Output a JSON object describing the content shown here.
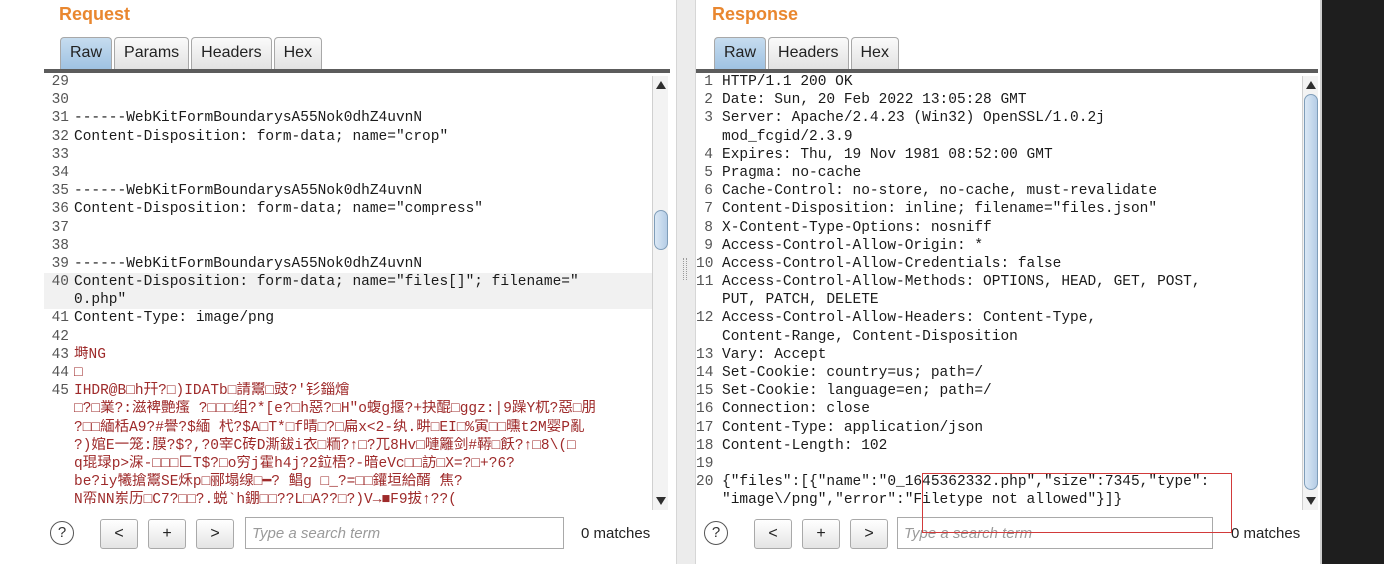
{
  "request": {
    "title": "Request",
    "tabs": [
      "Raw",
      "Params",
      "Headers",
      "Hex"
    ],
    "active_tab": "Raw",
    "lines": [
      {
        "n": "29",
        "t": ""
      },
      {
        "n": "30",
        "t": ""
      },
      {
        "n": "31",
        "t": "------WebKitFormBoundarysA55Nok0dhZ4uvnN"
      },
      {
        "n": "32",
        "t": "Content-Disposition: form-data; name=\"crop\""
      },
      {
        "n": "33",
        "t": ""
      },
      {
        "n": "34",
        "t": ""
      },
      {
        "n": "35",
        "t": "------WebKitFormBoundarysA55Nok0dhZ4uvnN"
      },
      {
        "n": "36",
        "t": "Content-Disposition: form-data; name=\"compress\""
      },
      {
        "n": "37",
        "t": ""
      },
      {
        "n": "38",
        "t": ""
      },
      {
        "n": "39",
        "t": "------WebKitFormBoundarysA55Nok0dhZ4uvnN"
      },
      {
        "n": "40",
        "t": "Content-Disposition: form-data; name=\"files[]\"; filename=\""
      },
      {
        "n": "",
        "t": "0.php\""
      },
      {
        "n": "41",
        "t": "Content-Type: image/png"
      },
      {
        "n": "42",
        "t": ""
      },
      {
        "n": "43",
        "t": "塒NG"
      },
      {
        "n": "44",
        "t": "□"
      },
      {
        "n": "45",
        "t": "IHDR@B□h幵?□)IDATb□請鬻□豉?'钐錙燴"
      },
      {
        "n": "",
        "t": "□?□業?:滋裨艶瘙 ?□□□组?*[e?□h惡?□H\"o蝮g揠?+抉醌□ggz:|9躁Y杌?惡□朋"
      },
      {
        "n": "",
        "t": "?□□緬栝A9?#譽?$緬 杙?$A□T*□f晴□?□扁x<2-纨.畊□EI□%寅□□曛t2M婴P亂"
      },
      {
        "n": "",
        "t": "?)婠E一笼:膜?$?,?0宰C砖D澌鈸i衣□粫?↑□?兀8Hv□嗹籬剑#鞯□飫?↑□8\\(□"
      },
      {
        "n": "",
        "t": "q琨琭p>淭-□□□匚T$?□o穷j霍h4j?2鉝梧?-暗eVc□□訪□X=?□+?6?"
      },
      {
        "n": "",
        "t": "be?iy犧搶鬻SE秌p□郦塌缐□━? 鲳g □_?=□□鑵垣給醑 焦?"
      },
      {
        "n": "",
        "t": "N帟NN岽历□C7?□□?.蜕`h錋□□??L□A??□?)V→■F9拔↑??("
      }
    ],
    "highlight_index": 11,
    "binary_start": 15,
    "search": {
      "placeholder": "Type a search term",
      "matches": "0 matches"
    },
    "buttons": {
      "help": "?",
      "prev": "<",
      "add": "+",
      "next": ">"
    }
  },
  "response": {
    "title": "Response",
    "tabs": [
      "Raw",
      "Headers",
      "Hex"
    ],
    "active_tab": "Raw",
    "lines": [
      {
        "n": "1",
        "t": "HTTP/1.1 200 OK"
      },
      {
        "n": "2",
        "t": "Date: Sun, 20 Feb 2022 13:05:28 GMT"
      },
      {
        "n": "3",
        "t": "Server: Apache/2.4.23 (Win32) OpenSSL/1.0.2j"
      },
      {
        "n": "",
        "t": "mod_fcgid/2.3.9"
      },
      {
        "n": "4",
        "t": "Expires: Thu, 19 Nov 1981 08:52:00 GMT"
      },
      {
        "n": "5",
        "t": "Pragma: no-cache"
      },
      {
        "n": "6",
        "t": "Cache-Control: no-store, no-cache, must-revalidate"
      },
      {
        "n": "7",
        "t": "Content-Disposition: inline; filename=\"files.json\""
      },
      {
        "n": "8",
        "t": "X-Content-Type-Options: nosniff"
      },
      {
        "n": "9",
        "t": "Access-Control-Allow-Origin: *"
      },
      {
        "n": "10",
        "t": "Access-Control-Allow-Credentials: false"
      },
      {
        "n": "11",
        "t": "Access-Control-Allow-Methods: OPTIONS, HEAD, GET, POST,"
      },
      {
        "n": "",
        "t": "PUT, PATCH, DELETE"
      },
      {
        "n": "12",
        "t": "Access-Control-Allow-Headers: Content-Type,"
      },
      {
        "n": "",
        "t": "Content-Range, Content-Disposition"
      },
      {
        "n": "13",
        "t": "Vary: Accept"
      },
      {
        "n": "14",
        "t": "Set-Cookie: country=us; path=/"
      },
      {
        "n": "15",
        "t": "Set-Cookie: language=en; path=/"
      },
      {
        "n": "16",
        "t": "Connection: close"
      },
      {
        "n": "17",
        "t": "Content-Type: application/json"
      },
      {
        "n": "18",
        "t": "Content-Length: 102"
      },
      {
        "n": "19",
        "t": ""
      },
      {
        "n": "20",
        "t": "{\"files\":[{\"name\":\"0_1645362332.php\",\"size\":7345,\"type\":"
      },
      {
        "n": "",
        "t": "\"image\\/png\",\"error\":\"Filetype not allowed\"}]}"
      }
    ],
    "search": {
      "placeholder": "Type a search term",
      "matches": "0 matches"
    },
    "buttons": {
      "help": "?",
      "prev": "<",
      "add": "+",
      "next": ">"
    }
  }
}
